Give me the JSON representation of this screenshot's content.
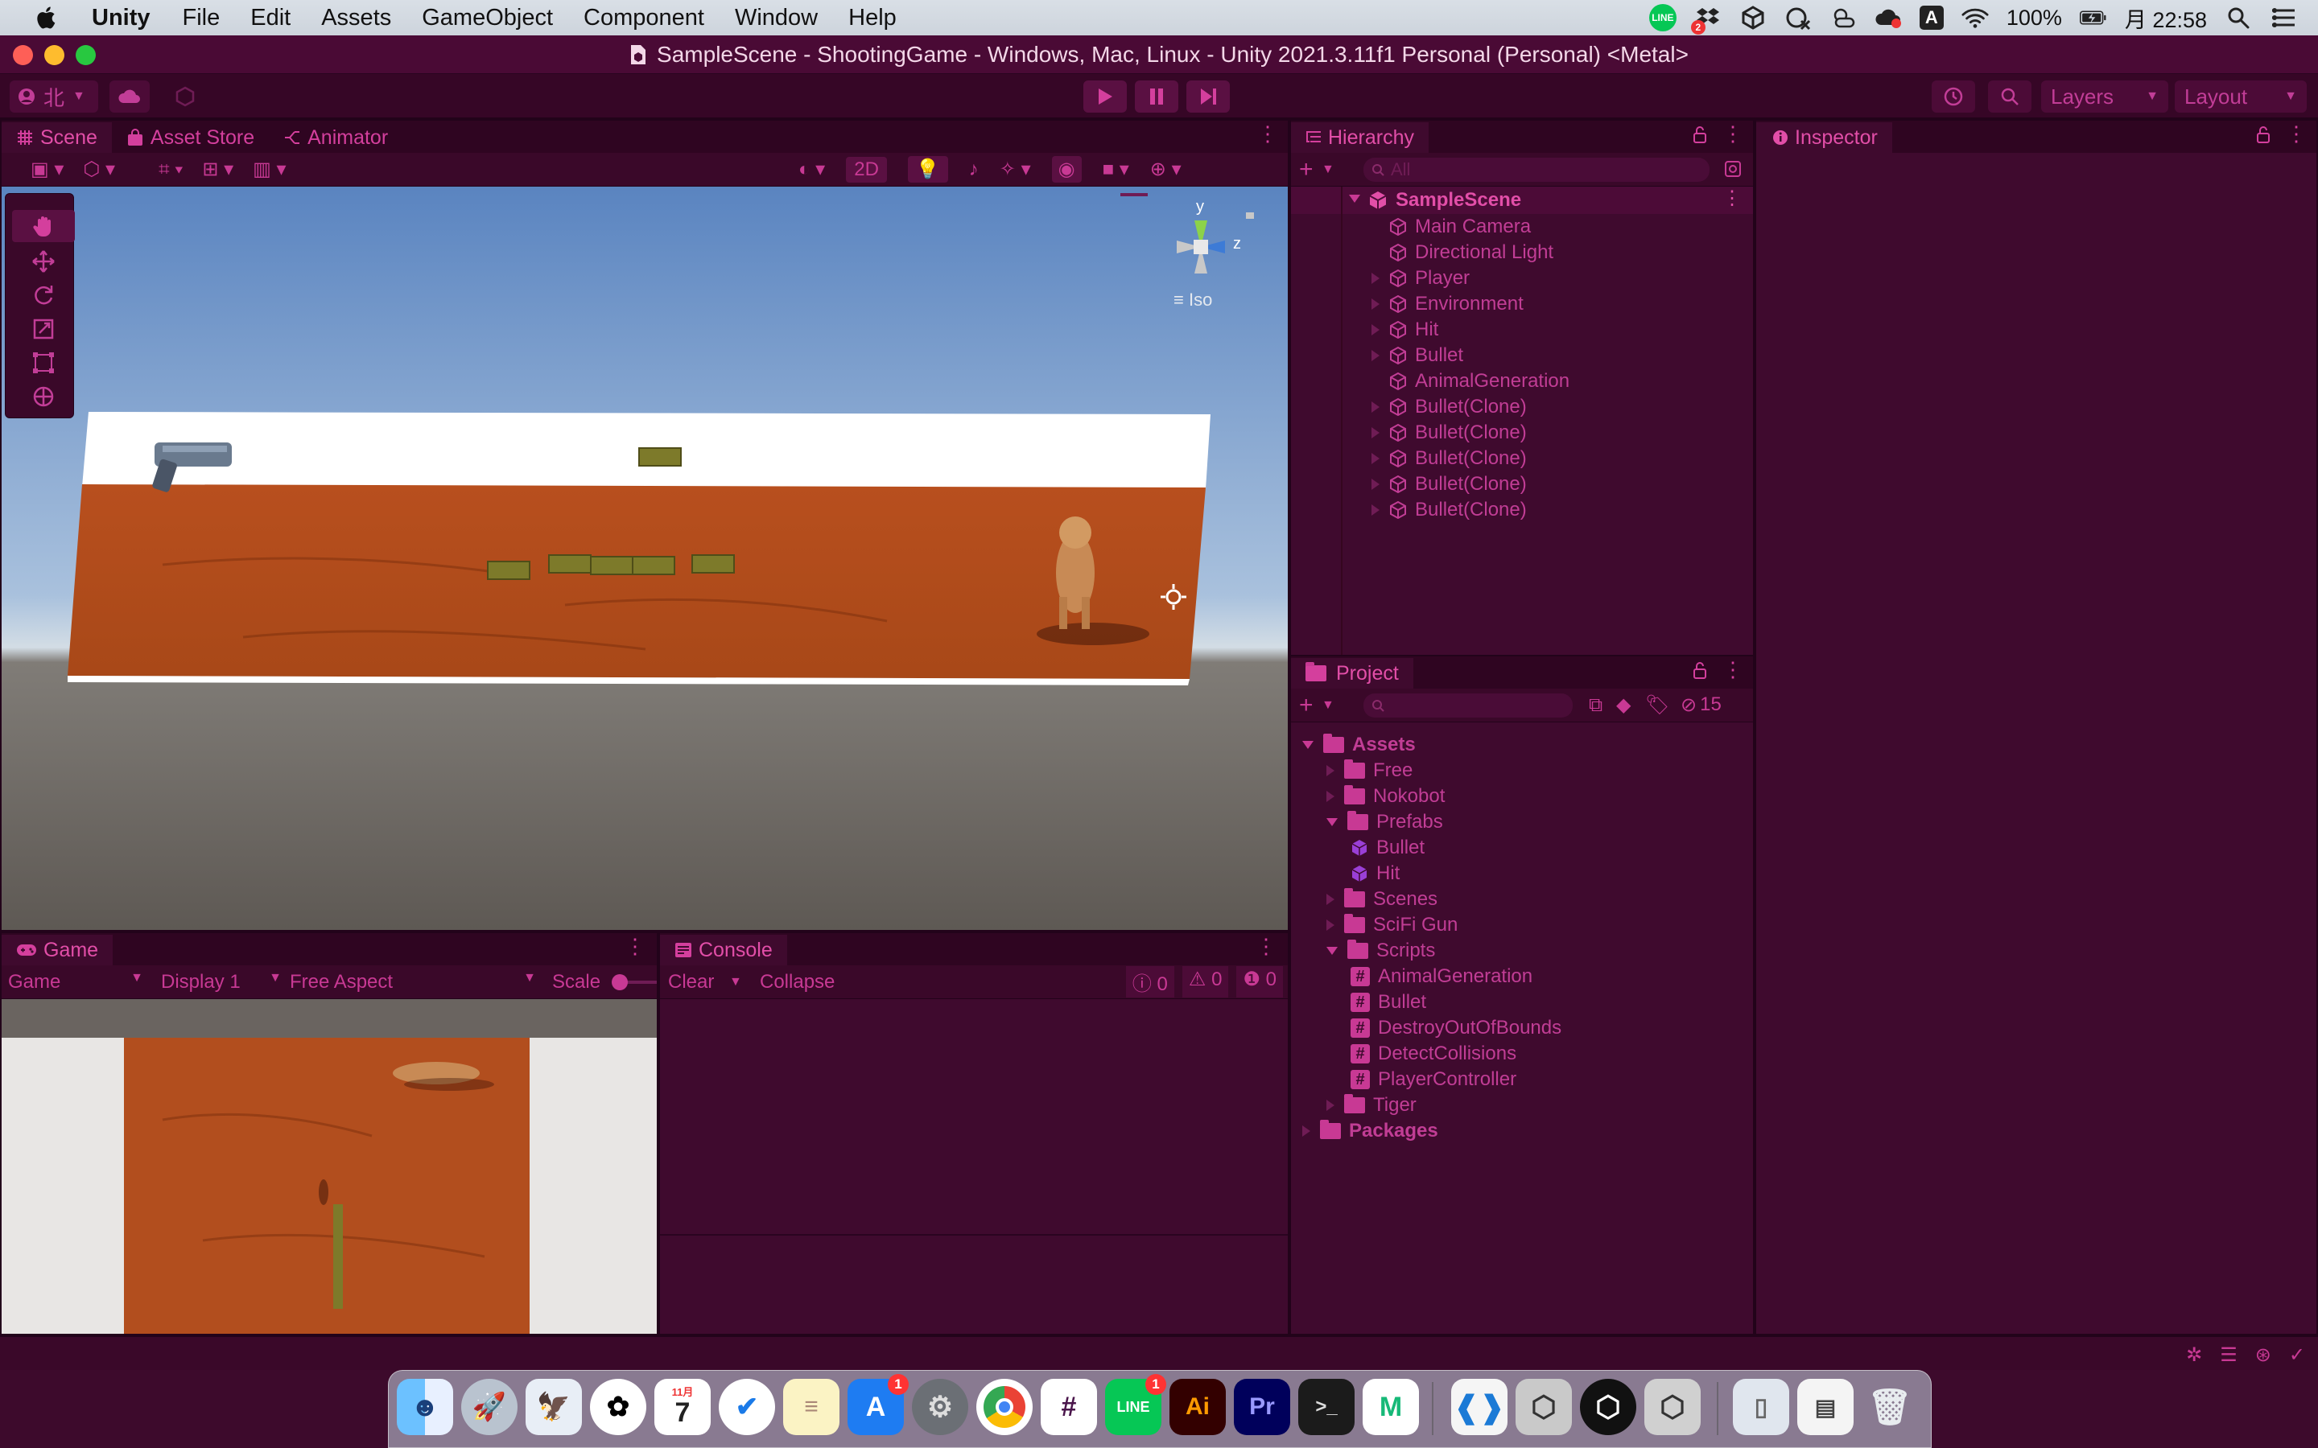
{
  "mac_menubar": {
    "app_name": "Unity",
    "menus": [
      "File",
      "Edit",
      "Assets",
      "GameObject",
      "Component",
      "Window",
      "Help"
    ],
    "battery": "100%",
    "clock": "月 22:58",
    "tray": {
      "line_label": "LINE",
      "dropbox_badge": "2",
      "input_label": "A"
    }
  },
  "window": {
    "title": "SampleScene - ShootingGame - Windows, Mac, Linux - Unity 2021.3.11f1 Personal (Personal) <Metal>"
  },
  "toolbar": {
    "account_label": "北",
    "layers_label": "Layers",
    "layout_label": "Layout"
  },
  "scene_panel": {
    "tabs": [
      {
        "label": "Scene"
      },
      {
        "label": "Asset Store"
      },
      {
        "label": "Animator"
      }
    ],
    "toggle_2d": "2D",
    "gizmo": {
      "y_label": "y",
      "z_label": "z",
      "projection_label": "Iso"
    }
  },
  "hierarchy": {
    "tab_label": "Hierarchy",
    "search_placeholder": "All",
    "scene_name": "SampleScene",
    "items": [
      {
        "label": "Main Camera",
        "expandable": false
      },
      {
        "label": "Directional Light",
        "expandable": false
      },
      {
        "label": "Player",
        "expandable": true
      },
      {
        "label": "Environment",
        "expandable": true
      },
      {
        "label": "Hit",
        "expandable": true
      },
      {
        "label": "Bullet",
        "expandable": true
      },
      {
        "label": "AnimalGeneration",
        "expandable": false
      },
      {
        "label": "Bullet(Clone)",
        "expandable": true
      },
      {
        "label": "Bullet(Clone)",
        "expandable": true
      },
      {
        "label": "Bullet(Clone)",
        "expandable": true
      },
      {
        "label": "Bullet(Clone)",
        "expandable": true
      },
      {
        "label": "Bullet(Clone)",
        "expandable": true
      }
    ]
  },
  "inspector": {
    "tab_label": "Inspector"
  },
  "project": {
    "tab_label": "Project",
    "hidden_count": "15",
    "tree": [
      {
        "label": "Assets",
        "type": "folder",
        "depth": 0,
        "open": true,
        "bold": true
      },
      {
        "label": "Free",
        "type": "folder",
        "depth": 1,
        "open": false
      },
      {
        "label": "Nokobot",
        "type": "folder",
        "depth": 1,
        "open": false
      },
      {
        "label": "Prefabs",
        "type": "folder",
        "depth": 1,
        "open": true
      },
      {
        "label": "Bullet",
        "type": "prefab",
        "depth": 2
      },
      {
        "label": "Hit",
        "type": "prefab",
        "depth": 2
      },
      {
        "label": "Scenes",
        "type": "folder",
        "depth": 1,
        "open": false
      },
      {
        "label": "SciFi Gun",
        "type": "folder",
        "depth": 1,
        "open": false
      },
      {
        "label": "Scripts",
        "type": "folder",
        "depth": 1,
        "open": true
      },
      {
        "label": "AnimalGeneration",
        "type": "script",
        "depth": 2
      },
      {
        "label": "Bullet",
        "type": "script",
        "depth": 2
      },
      {
        "label": "DestroyOutOfBounds",
        "type": "script",
        "depth": 2
      },
      {
        "label": "DetectCollisions",
        "type": "script",
        "depth": 2
      },
      {
        "label": "PlayerController",
        "type": "script",
        "depth": 2
      },
      {
        "label": "Tiger",
        "type": "folder",
        "depth": 1,
        "open": false
      },
      {
        "label": "Packages",
        "type": "folder",
        "depth": 0,
        "open": false,
        "bold": true
      }
    ]
  },
  "game_panel": {
    "tab_label": "Game",
    "mode_label": "Game",
    "display_label": "Display 1",
    "aspect_label": "Free Aspect",
    "scale_label": "Scale"
  },
  "console_panel": {
    "tab_label": "Console",
    "clear_label": "Clear",
    "collapse_label": "Collapse",
    "log_count": "0",
    "warn_count": "0",
    "error_count": "0"
  },
  "dock": {
    "calendar_month": "11月",
    "calendar_day": "7",
    "appstore_badge": "1",
    "line_badge": "1",
    "illustrator_label": "Ai",
    "premiere_label": "Pr",
    "terminal_label": ">_"
  }
}
